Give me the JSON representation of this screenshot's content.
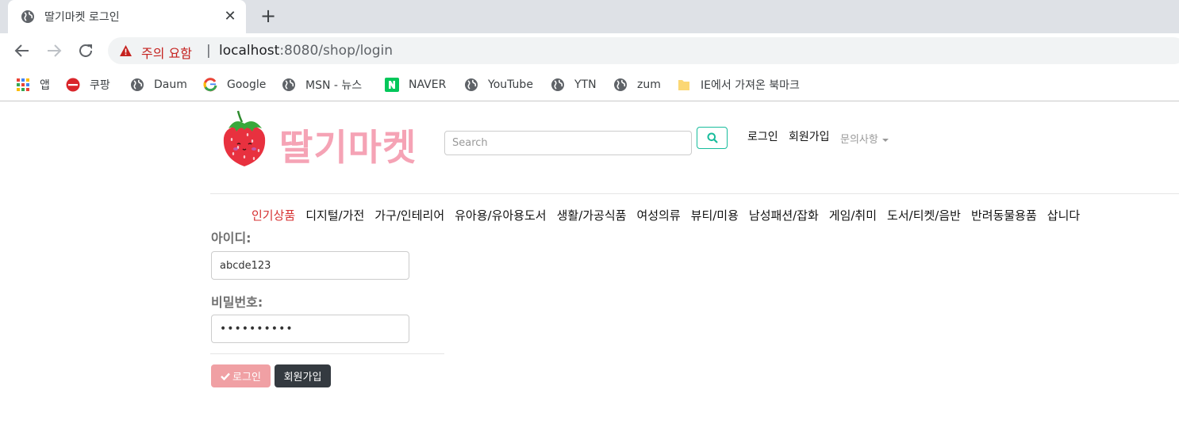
{
  "browser": {
    "tab": {
      "title": "딸기마켓 로그인",
      "close_glyph": "✕",
      "favicon": "globe-icon"
    },
    "new_tab_glyph": "+",
    "omnibox": {
      "security_warning": "주의 요함",
      "separator": "|",
      "url_host": "localhost",
      "url_path": ":8080/shop/login"
    },
    "bookmarks": [
      {
        "label": "앱",
        "icon": "apps-grid-icon"
      },
      {
        "label": "쿠팡",
        "icon": "coupang-icon"
      },
      {
        "label": "Daum",
        "icon": "globe-icon"
      },
      {
        "label": "Google",
        "icon": "google-icon"
      },
      {
        "label": "MSN - 뉴스",
        "icon": "globe-icon"
      },
      {
        "label": "NAVER",
        "icon": "naver-icon"
      },
      {
        "label": "YouTube",
        "icon": "globe-icon"
      },
      {
        "label": "YTN",
        "icon": "globe-icon"
      },
      {
        "label": "zum",
        "icon": "globe-icon"
      },
      {
        "label": "IE에서 가져온 북마크",
        "icon": "folder-icon"
      }
    ]
  },
  "site": {
    "logo_text": "딸기마켓",
    "brand_color": "#f5a3b5",
    "search": {
      "placeholder": "Search"
    },
    "nav": {
      "login": "로그인",
      "signup": "회원가입",
      "inquiry": "문의사항"
    },
    "categories": [
      {
        "label": "인기상품",
        "active": true
      },
      {
        "label": "디지털/가전",
        "active": false
      },
      {
        "label": "가구/인테리어",
        "active": false
      },
      {
        "label": "유아용/유아용도서",
        "active": false
      },
      {
        "label": "생활/가공식품",
        "active": false
      },
      {
        "label": "여성의류",
        "active": false
      },
      {
        "label": "뷰티/미용",
        "active": false
      },
      {
        "label": "남성패션/잡화",
        "active": false
      },
      {
        "label": "게임/취미",
        "active": false
      },
      {
        "label": "도서/티켓/음반",
        "active": false
      },
      {
        "label": "반려동물용품",
        "active": false
      },
      {
        "label": "삽니다",
        "active": false
      }
    ]
  },
  "login_form": {
    "id_label": "아이디:",
    "id_value": "abcde123",
    "password_label": "비밀번호:",
    "password_value": "••••••••••",
    "login_button": "로그인",
    "signup_button": "회원가입"
  }
}
